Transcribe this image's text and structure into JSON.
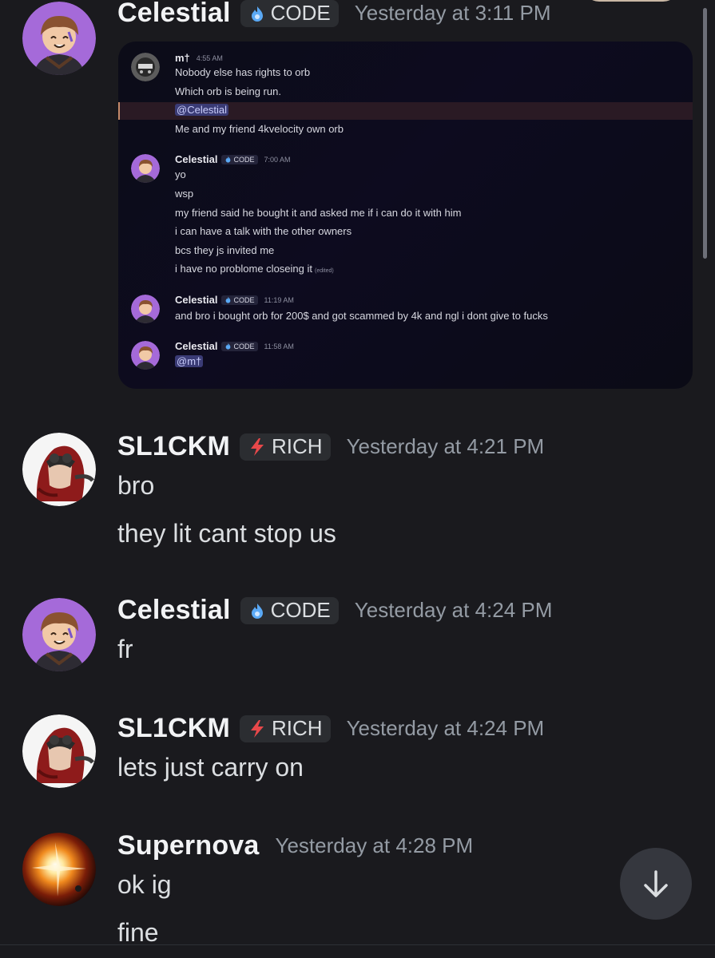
{
  "messages": [
    {
      "user": "Celestial",
      "tag": "CODE",
      "timestamp": "Yesterday at 3:11 PM",
      "embed": {
        "messages": [
          {
            "user": "m†",
            "timestamp": "4:55 AM",
            "lines": [
              "Nobody else has rights to orb",
              "Which orb is being run.",
              "@Celestial",
              "Me and my friend 4kvelocity own orb"
            ]
          },
          {
            "user": "Celestial",
            "tag": "CODE",
            "timestamp": "7:00 AM",
            "lines": [
              "yo",
              "wsp",
              "my friend said he bought it and asked me if i can do it with him",
              "i can have a talk with the other owners",
              "bcs they js invited me",
              "i have no problome closeing it"
            ],
            "edited": "(edited)"
          },
          {
            "user": "Celestial",
            "tag": "CODE",
            "timestamp": "11:19 AM",
            "lines": [
              "and bro i bought orb for 200$ and got scammed by 4k and ngl i dont give to fucks"
            ]
          },
          {
            "user": "Celestial",
            "tag": "CODE",
            "timestamp": "11:58 AM",
            "lines": [
              "@m†"
            ]
          }
        ]
      }
    },
    {
      "user": "SL1CKM",
      "tag": "RICH",
      "timestamp": "Yesterday at 4:21 PM",
      "lines": [
        "bro",
        "they lit cant stop us"
      ]
    },
    {
      "user": "Celestial",
      "tag": "CODE",
      "timestamp": "Yesterday at 4:24 PM",
      "lines": [
        "fr"
      ]
    },
    {
      "user": "SL1CKM",
      "tag": "RICH",
      "timestamp": "Yesterday at 4:24 PM",
      "lines": [
        "lets just carry on"
      ]
    },
    {
      "user": "Supernova",
      "timestamp": "Yesterday at 4:28 PM",
      "lines": [
        "ok ig",
        "fine"
      ]
    }
  ],
  "colors": {
    "background": "#1a1a1e",
    "code_tag_icon": "#5aa9f5",
    "rich_tag_icon": "#e8484a",
    "mention_bg": "#3a3b75"
  },
  "icons": {
    "code_tag": "flame-icon",
    "rich_tag": "lightning-icon",
    "scroll_button": "arrow-down-icon"
  }
}
